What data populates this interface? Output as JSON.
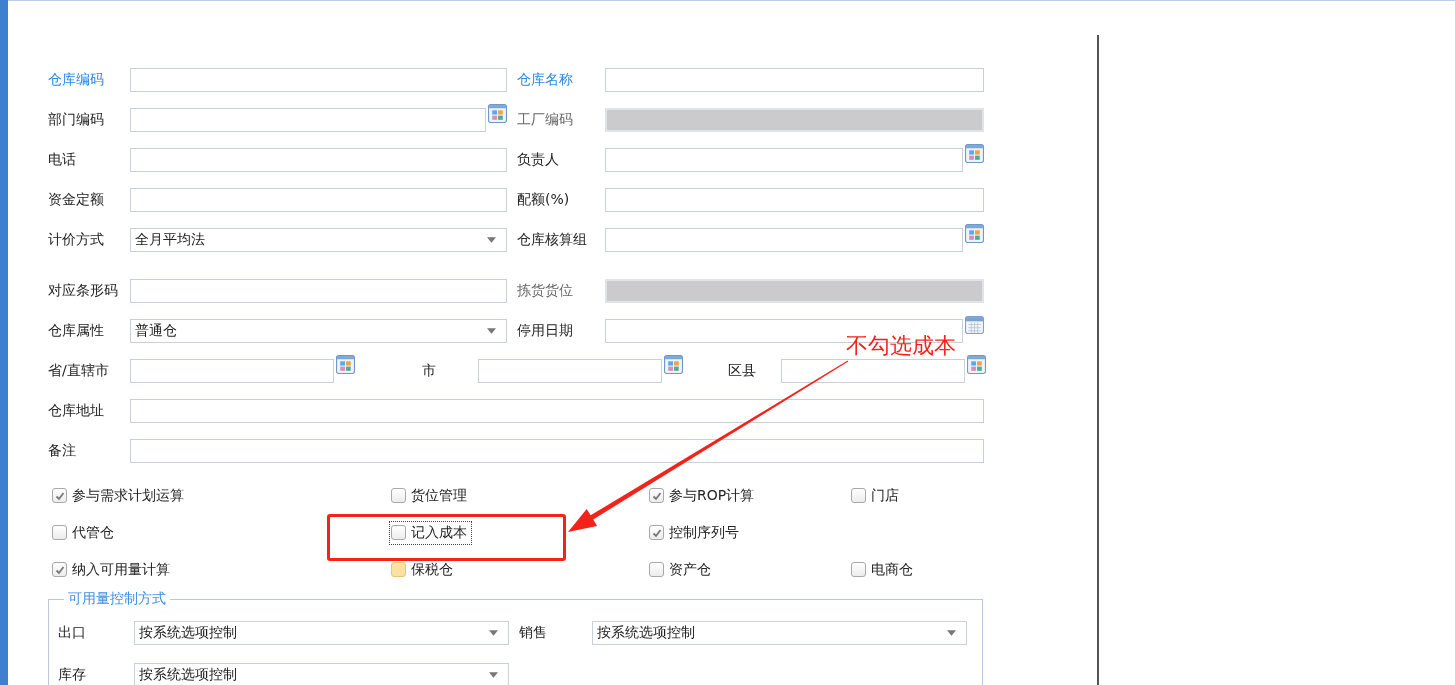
{
  "rows": [
    {
      "fields": [
        {
          "label": "仓库编码",
          "kind": "text",
          "required": true
        },
        {
          "label": "仓库名称",
          "kind": "text",
          "required": true
        }
      ]
    },
    {
      "fields": [
        {
          "label": "部门编码",
          "kind": "picker",
          "required": false
        },
        {
          "label": "工厂编码",
          "kind": "disabled",
          "required": false
        }
      ]
    },
    {
      "fields": [
        {
          "label": "电话",
          "kind": "text",
          "required": false
        },
        {
          "label": "负责人",
          "kind": "picker",
          "required": false
        }
      ]
    },
    {
      "fields": [
        {
          "label": "资金定额",
          "kind": "text",
          "required": false
        },
        {
          "label": "配额(%)",
          "kind": "text",
          "required": false
        }
      ]
    },
    {
      "fields": [
        {
          "label": "计价方式",
          "kind": "select",
          "required": false,
          "value": "全月平均法"
        },
        {
          "label": "仓库核算组",
          "kind": "picker",
          "required": false
        }
      ]
    },
    {
      "fields": [
        {
          "label": "对应条形码",
          "kind": "text",
          "required": false
        },
        {
          "label": "拣货货位",
          "kind": "disabled",
          "required": false
        }
      ]
    },
    {
      "fields": [
        {
          "label": "仓库属性",
          "kind": "select",
          "required": false,
          "value": "普通仓"
        },
        {
          "label": "停用日期",
          "kind": "date",
          "required": false
        }
      ]
    },
    {
      "fields": [
        {
          "label": "省/直辖市",
          "kind": "picker",
          "required": false
        },
        {
          "label": "市",
          "kind": "picker",
          "required": false
        },
        {
          "label": "区县",
          "kind": "picker",
          "required": false
        }
      ]
    },
    {
      "fields": [
        {
          "label": "仓库地址",
          "kind": "text",
          "required": false
        }
      ]
    },
    {
      "fields": [
        {
          "label": "备注",
          "kind": "text",
          "required": false
        }
      ]
    }
  ],
  "option_rows": [
    [
      {
        "label": "参与需求计划运算",
        "checked": true,
        "highlighted": false,
        "focused": false
      },
      {
        "label": "货位管理",
        "checked": false,
        "highlighted": false,
        "focused": false
      },
      {
        "label": "参与ROP计算",
        "checked": true,
        "highlighted": false,
        "focused": false
      },
      {
        "label": "门店",
        "checked": false,
        "highlighted": false,
        "focused": false
      }
    ],
    [
      {
        "label": "代管仓",
        "checked": false,
        "highlighted": false,
        "focused": false
      },
      {
        "label": "记入成本",
        "checked": false,
        "highlighted": false,
        "focused": true
      },
      {
        "label": "控制序列号",
        "checked": true,
        "highlighted": false,
        "focused": false
      }
    ],
    [
      {
        "label": "纳入可用量计算",
        "checked": true,
        "highlighted": false,
        "focused": false
      },
      {
        "label": "保税仓",
        "checked": false,
        "highlighted": true,
        "focused": false
      },
      {
        "label": "资产仓",
        "checked": false,
        "highlighted": false,
        "focused": false
      },
      {
        "label": "电商仓",
        "checked": false,
        "highlighted": false,
        "focused": false
      }
    ]
  ],
  "availability_control": {
    "title": "可用量控制方式",
    "rows": [
      [
        {
          "label": "出口",
          "value": "按系统选项控制"
        },
        {
          "label": "销售",
          "value": "按系统选项控制"
        }
      ],
      [
        {
          "label": "库存",
          "value": "按系统选项控制"
        }
      ]
    ]
  },
  "annotation": {
    "note": "不勾选成本"
  }
}
